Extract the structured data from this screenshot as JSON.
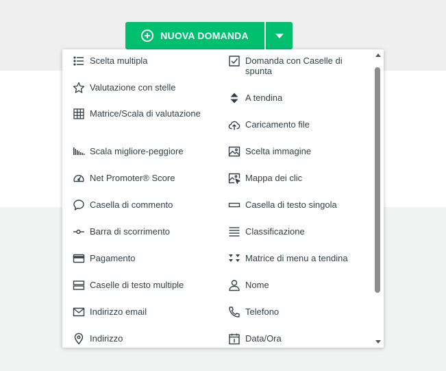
{
  "toolbar": {
    "new_question_label": "NUOVA DOMANDA"
  },
  "colors": {
    "accent": "#00bf6f",
    "text": "#333e48",
    "background": "#efefef"
  },
  "menu": {
    "left": [
      {
        "label": "Scelta multipla",
        "icon": "list-icon"
      },
      {
        "label": "Valutazione con stelle",
        "icon": "star-icon"
      },
      {
        "label": "Matrice/Scala di valutazione",
        "icon": "grid-icon"
      },
      {
        "label": "Scala migliore-peggiore",
        "icon": "bars-scale-icon"
      },
      {
        "label": "Net Promoter® Score",
        "icon": "gauge-icon"
      },
      {
        "label": "Casella di commento",
        "icon": "speech-bubble-icon"
      },
      {
        "label": "Barra di scorrimento",
        "icon": "slider-icon"
      },
      {
        "label": "Pagamento",
        "icon": "credit-card-icon"
      },
      {
        "label": "Caselle di testo multiple",
        "icon": "stacked-boxes-icon"
      },
      {
        "label": "Indirizzo email",
        "icon": "envelope-icon"
      },
      {
        "label": "Indirizzo",
        "icon": "map-pin-icon"
      }
    ],
    "right": [
      {
        "label": "Domanda con Caselle di spunta",
        "icon": "checkbox-icon"
      },
      {
        "label": "A tendina",
        "icon": "up-down-arrows-icon"
      },
      {
        "label": "Caricamento file",
        "icon": "cloud-upload-icon"
      },
      {
        "label": "Scelta immagine",
        "icon": "image-icon"
      },
      {
        "label": "Mappa dei clic",
        "icon": "image-click-icon"
      },
      {
        "label": "Casella di testo singola",
        "icon": "text-box-icon"
      },
      {
        "label": "Classificazione",
        "icon": "lines-icon"
      },
      {
        "label": "Matrice di menu a tendina",
        "icon": "triangles-icon"
      },
      {
        "label": "Nome",
        "icon": "person-icon"
      },
      {
        "label": "Telefono",
        "icon": "phone-icon"
      },
      {
        "label": "Data/Ora",
        "icon": "calendar-icon"
      }
    ]
  }
}
